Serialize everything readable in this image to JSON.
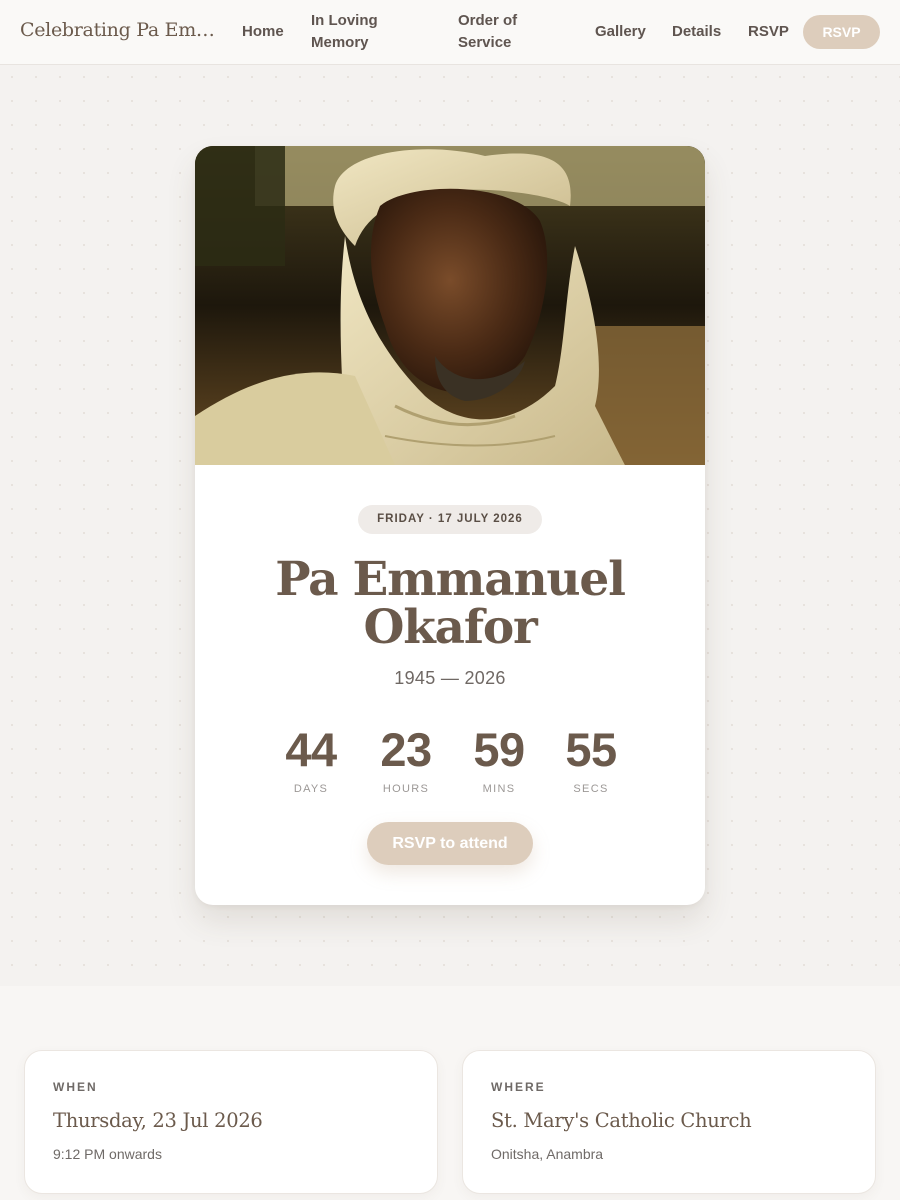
{
  "nav": {
    "brand": "Celebrating Pa Emman...",
    "links": [
      "Home",
      "In Loving Memory",
      "Order of Service",
      "Gallery",
      "Details",
      "RSVP"
    ],
    "rsvp_button": "RSVP"
  },
  "hero": {
    "date_pill": "FRIDAY · 17 JULY 2026",
    "name": "Pa Emmanuel Okafor",
    "years": "1945 — 2026",
    "countdown": [
      {
        "value": "44",
        "label": "DAYS"
      },
      {
        "value": "23",
        "label": "HOURS"
      },
      {
        "value": "59",
        "label": "MINS"
      },
      {
        "value": "55",
        "label": "SECS"
      }
    ],
    "rsvp_button": "RSVP to attend"
  },
  "info": {
    "when": {
      "label": "WHEN",
      "title": "Thursday, 23 Jul 2026",
      "sub": "9:12 PM onwards"
    },
    "where": {
      "label": "WHERE",
      "title": "St. Mary's Catholic Church",
      "sub": "Onitsha, Anambra"
    }
  },
  "colors": {
    "accent": "#ddcdbc",
    "text_brown": "#6b5a4c",
    "page_bg": "#f5f3f1"
  }
}
